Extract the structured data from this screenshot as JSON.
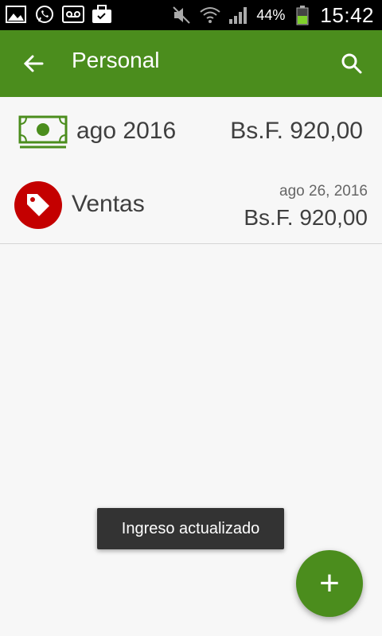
{
  "status_bar": {
    "time": "15:42",
    "battery_percent": "44%",
    "icons": [
      "gallery-icon",
      "whatsapp-icon",
      "voicemail-icon",
      "briefcase-icon",
      "mute-icon",
      "wifi-icon",
      "signal-icon",
      "battery-icon"
    ]
  },
  "app_bar": {
    "title": "Personal",
    "back_icon": "arrow-left-icon",
    "search_icon": "search-icon"
  },
  "summary": {
    "label": "ago 2016",
    "amount": "Bs.F. 920,00",
    "icon": "money-icon"
  },
  "transactions": [
    {
      "label": "Ventas",
      "date": "ago 26, 2016",
      "amount": "Bs.F. 920,00",
      "icon": "tag-icon",
      "color": "#c40000"
    }
  ],
  "toast": {
    "text": "Ingreso actualizado"
  },
  "fab": {
    "label": "+"
  },
  "colors": {
    "primary": "#4b8d1d",
    "status_bar": "#000000",
    "accent_red": "#c40000"
  }
}
